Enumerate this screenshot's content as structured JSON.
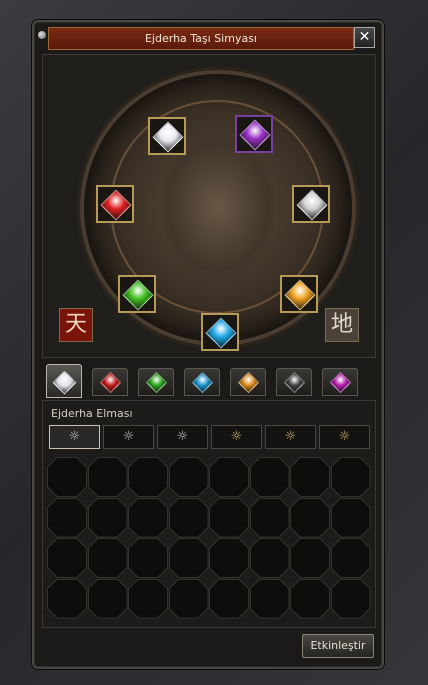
{
  "window": {
    "title": "Ejderha Taşı Simyası",
    "close_label": "✕"
  },
  "altar": {
    "left_symbol": "天",
    "right_symbol": "地",
    "slots": [
      {
        "name": "diamond",
        "color": "#e8e8f0"
      },
      {
        "name": "onyx",
        "color": "#9a30c8"
      },
      {
        "name": "ruby",
        "color": "#e02020"
      },
      {
        "name": "black-diamond",
        "color": "#d0d0d0"
      },
      {
        "name": "jade",
        "color": "#40c020"
      },
      {
        "name": "amber",
        "color": "#f0a020"
      },
      {
        "name": "sapphire",
        "color": "#20a8e8"
      }
    ]
  },
  "stone_tabs": [
    {
      "name": "diamond",
      "color": "#e0e0e8",
      "active": true
    },
    {
      "name": "ruby",
      "color": "#c01818"
    },
    {
      "name": "jade",
      "color": "#28a018"
    },
    {
      "name": "sapphire",
      "color": "#1890c8"
    },
    {
      "name": "amber",
      "color": "#d88818"
    },
    {
      "name": "onyx",
      "color": "#404040"
    },
    {
      "name": "garnet",
      "color": "#b018a8"
    }
  ],
  "section": {
    "label": "Ejderha Elması"
  },
  "subtabs": [
    "☼",
    "☼",
    "☼",
    "☼",
    "☼",
    "☼"
  ],
  "grid": {
    "rows": 4,
    "cols": 8
  },
  "activate_button": "Etkinleştir"
}
